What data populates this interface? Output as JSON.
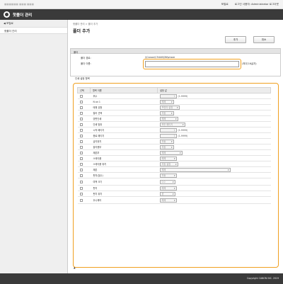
{
  "topbar": {
    "address": "■■■■■■ ■■■ ■■■",
    "portal": "포털로",
    "login_user": "로그인 사용자: Administrator 로그아웃"
  },
  "header": {
    "title": "핫폴더 관리"
  },
  "sidebar": {
    "back": "◀ 포털로",
    "items": [
      {
        "label": "핫폴더 관리"
      }
    ]
  },
  "main": {
    "breadcrumb": "핫폴더 관리 > 폴더 추가",
    "title": "폴더 추가",
    "add_label": "추가",
    "cancel_label": "취소",
    "printer": {
      "section": "폴더",
      "path_label": "폴더 경로:",
      "path_value": "\\\\Canon\\C5440\\DN\\share",
      "name_label": "폴더 이름:",
      "name_value": "",
      "hint": "(최대 16글자)"
    },
    "settings_label": "인쇄 설정 항목",
    "settings_headers": [
      "선택",
      "항목 이름",
      "설정 값"
    ],
    "rows": [
      {
        "group": "",
        "item": "부수",
        "type": "number",
        "value": "1",
        "range": "(1-9999)"
      },
      {
        "group": "",
        "item": "N on 1",
        "type": "select",
        "value": "해제"
      },
      {
        "group": "",
        "item": "매체 유형",
        "type": "select",
        "value": "프린터 설정"
      },
      {
        "group": "",
        "item": "컬러 선택",
        "type": "select",
        "value": "자동"
      },
      {
        "group": "",
        "item": "양면인쇄",
        "type": "select",
        "value": "해제"
      },
      {
        "group": "",
        "item": "인쇄 범위",
        "type": "select",
        "value": "모든 페이지"
      },
      {
        "group": "",
        "item": "시작 페이지",
        "type": "number",
        "value": "1",
        "range": "(1-9999)"
      },
      {
        "group": "",
        "item": "종료 페이지",
        "type": "number",
        "value": "1",
        "range": "(1-9999)"
      },
      {
        "group": "",
        "item": "급지위치",
        "type": "select",
        "value": "자동"
      },
      {
        "group": "",
        "item": "출지용부",
        "type": "select",
        "value": "자동"
      },
      {
        "group": "",
        "item": "제본부",
        "type": "select",
        "value": "해제"
      },
      {
        "group": "",
        "item": "스테이플",
        "type": "select",
        "value": "해제"
      },
      {
        "group": "",
        "item": "스테이플 위치",
        "type": "select",
        "value": "자동 설정"
      },
      {
        "group": "",
        "item": "제본",
        "type": "select",
        "value": "해제"
      },
      {
        "group": "",
        "item": "펀치(횟수)",
        "type": "select",
        "value": "자동"
      },
      {
        "group": "",
        "item": "여백 크기",
        "type": "select",
        "value": "0.0"
      },
      {
        "group": "",
        "item": "펀치",
        "type": "select",
        "value": "해제"
      },
      {
        "group": "",
        "item": "펀치 위치",
        "type": "select",
        "value": "왼"
      },
      {
        "group": "",
        "item": "두니제어",
        "type": "select",
        "value": "해제"
      }
    ],
    "top_link": "▲"
  },
  "footer": {
    "copyright": "Copyright CANON INC. 2019"
  },
  "colors": {
    "accent_highlight": "#f0a020",
    "header_bg": "#3a3a3a"
  }
}
